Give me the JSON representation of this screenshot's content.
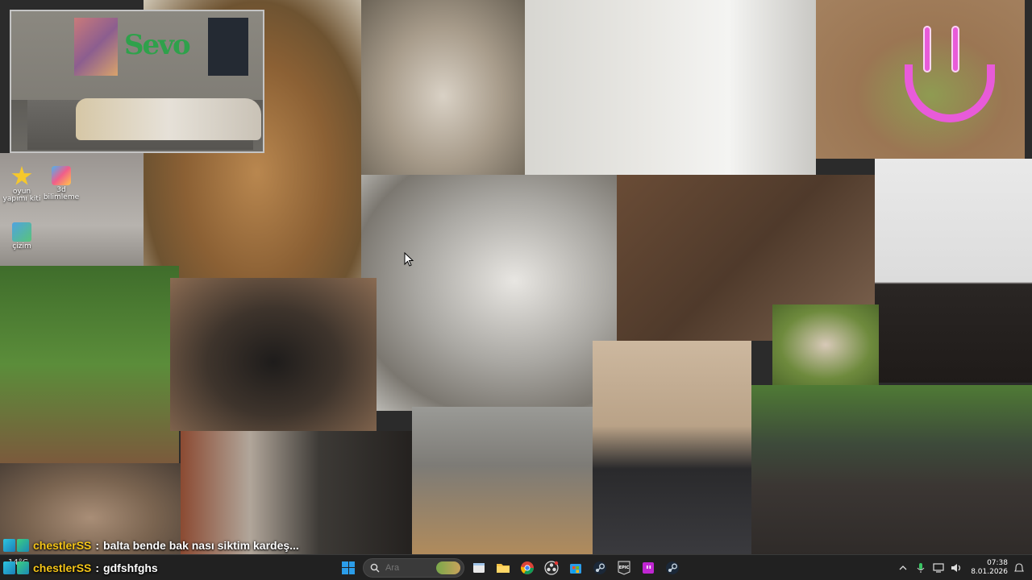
{
  "wallpaper": {
    "webcam_overlay": {
      "wall_tag": "Sevo"
    },
    "desktop_icons": [
      {
        "icon": "star-icon",
        "label": "oyun yapımı kiti"
      },
      {
        "icon": "3d-builder-icon",
        "label": "3d bilimleme"
      },
      {
        "icon": "paint-icon",
        "label": "çizim"
      }
    ]
  },
  "chat": {
    "messages": [
      {
        "user": "chestlerSS",
        "separator": ":",
        "text": "balta bende bak nası siktim kardeş..."
      },
      {
        "user": "chestlerSS",
        "separator": ":",
        "text": "gdfshfghs"
      }
    ]
  },
  "taskbar": {
    "weather": {
      "temp": "14°C",
      "condition": ""
    },
    "search": {
      "placeholder": "Ara"
    },
    "pinned": [
      {
        "name": "file-explorer",
        "icon": "folder-icon"
      },
      {
        "name": "chrome",
        "icon": "chrome-icon"
      },
      {
        "name": "obs",
        "icon": "obs-icon"
      },
      {
        "name": "microsoft-store",
        "icon": "store-icon"
      },
      {
        "name": "steam",
        "icon": "steam-icon"
      },
      {
        "name": "epic-games",
        "icon": "epic-icon"
      },
      {
        "name": "twitch",
        "icon": "twitch-icon"
      },
      {
        "name": "steam-2",
        "icon": "steam-icon"
      }
    ],
    "tray": {
      "time": "07:38",
      "date": "8.01.2026"
    }
  },
  "colors": {
    "chat_username": "#f5c518",
    "smile_overlay": "#e85bd9",
    "taskbar_bg": "#202020",
    "windows_blue": "#2b9de9"
  }
}
